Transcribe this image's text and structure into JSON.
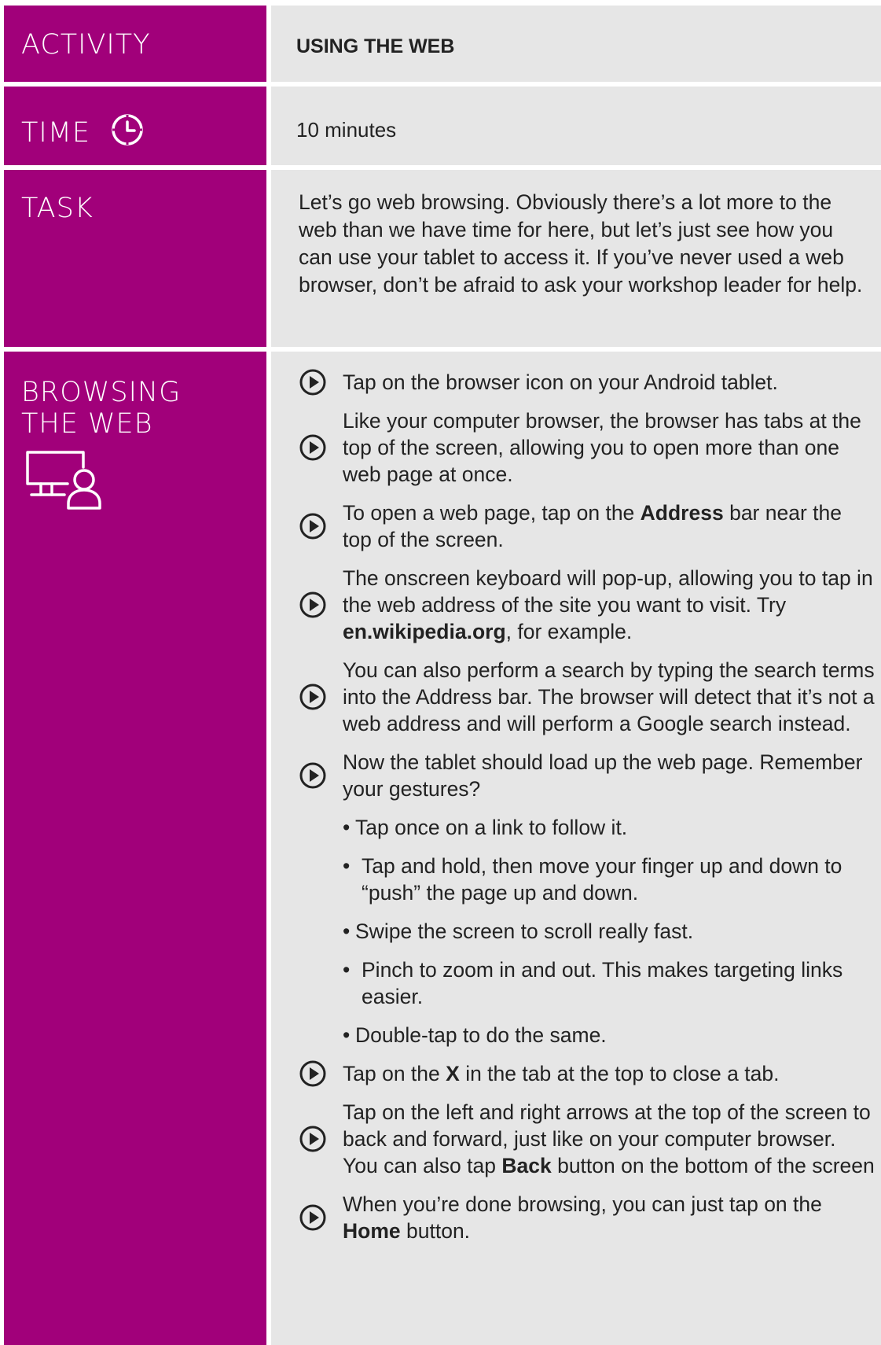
{
  "activity": {
    "label": "ACTIVITY",
    "value": "USING THE WEB"
  },
  "time": {
    "label": "TIME",
    "icon": "clock-icon",
    "value": "10 minutes"
  },
  "task": {
    "label": "TASK",
    "text": "Let’s go web browsing. Obviously there’s a lot more to the web than we have time for here, but let’s just see how you can use your tablet to access it. If you’ve never used a web browser, don’t be afraid to ask your workshop leader for help."
  },
  "browsing": {
    "label_line1": "BROWSING",
    "label_line2": "THE WEB",
    "icon": "computer-user-icon",
    "steps": [
      {
        "before": "Tap on the browser icon on your Android tablet."
      },
      {
        "before": "Like your computer browser, the browser has tabs at the top of the screen, allowing you to open more than one web page at once."
      },
      {
        "before": "To open a web page, tap on the ",
        "bold": "Address",
        "after": " bar near the top of the screen."
      },
      {
        "before": "The onscreen keyboard will pop-up, allowing you to tap in the web address of the site you want to visit. Try ",
        "bold": "en.wikipedia.org",
        "after": ", for example."
      },
      {
        "before": "You can also perform a search by typing the search terms into the Address bar. The browser will detect that it’s not a web address and will perform a Google search instead."
      },
      {
        "before": "Now the tablet should load up the web page. Remember your gestures?"
      },
      {
        "before": "Tap on the ",
        "bold": "X",
        "after": " in the tab at the top to close a tab."
      },
      {
        "before": "Tap on the left and right arrows at the top of the screen to back and forward, just like on your computer browser.  You can also tap ",
        "bold": "Back",
        "after": " button on the bottom of the screen"
      },
      {
        "before": "When you’re done browsing, you can just tap on the ",
        "bold": "Home",
        "after": " button."
      }
    ],
    "gestures": [
      "Tap once on a link to follow it.",
      "Tap and hold, then move your finger up and down to “push” the page up and down.",
      "Swipe the screen to scroll really fast.",
      "Pinch to zoom in and out. This makes targeting links easier.",
      "Double-tap to do the same."
    ],
    "bullet": "•"
  }
}
